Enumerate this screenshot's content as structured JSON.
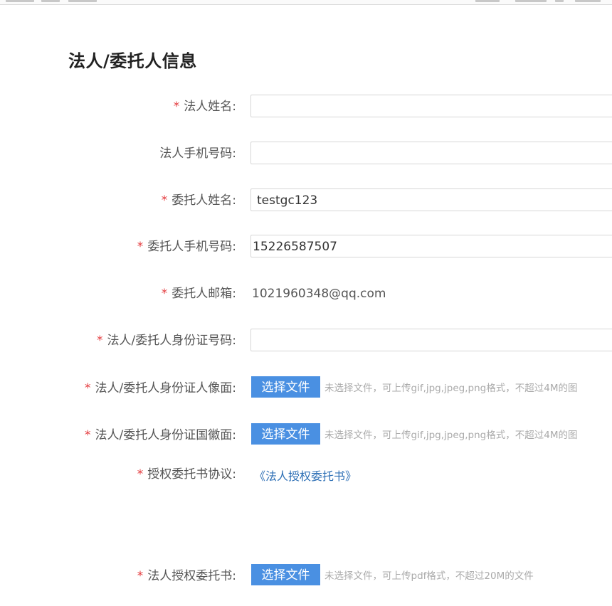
{
  "section": {
    "title": "法人/委托人信息"
  },
  "form": {
    "required_mark": "*",
    "legal_name": {
      "label": "法人姓名:",
      "value": ""
    },
    "legal_phone": {
      "label": "法人手机号码:",
      "value": ""
    },
    "agent_name": {
      "label": "委托人姓名:",
      "value": "testgc123"
    },
    "agent_phone": {
      "label": "委托人手机号码:",
      "value": "15226587507"
    },
    "agent_email": {
      "label": "委托人邮箱:",
      "value": "1021960348@qq.com"
    },
    "id_number": {
      "label": "法人/委托人身份证号码:",
      "value": ""
    },
    "id_front": {
      "label": "法人/委托人身份证人像面:",
      "button": "选择文件",
      "hint": "未选择文件，可上传gif,jpg,jpeg,png格式，不超过4M的图"
    },
    "id_back": {
      "label": "法人/委托人身份证国徽面:",
      "button": "选择文件",
      "hint": "未选择文件，可上传gif,jpg,jpeg,png格式，不超过4M的图"
    },
    "agreement": {
      "label": "授权委托书协议:",
      "link": "《法人授权委托书》"
    },
    "authorization_letter": {
      "label": "法人授权委托书:",
      "button": "选择文件",
      "hint": "未选择文件，可上传pdf格式，不超过20M的文件"
    }
  }
}
